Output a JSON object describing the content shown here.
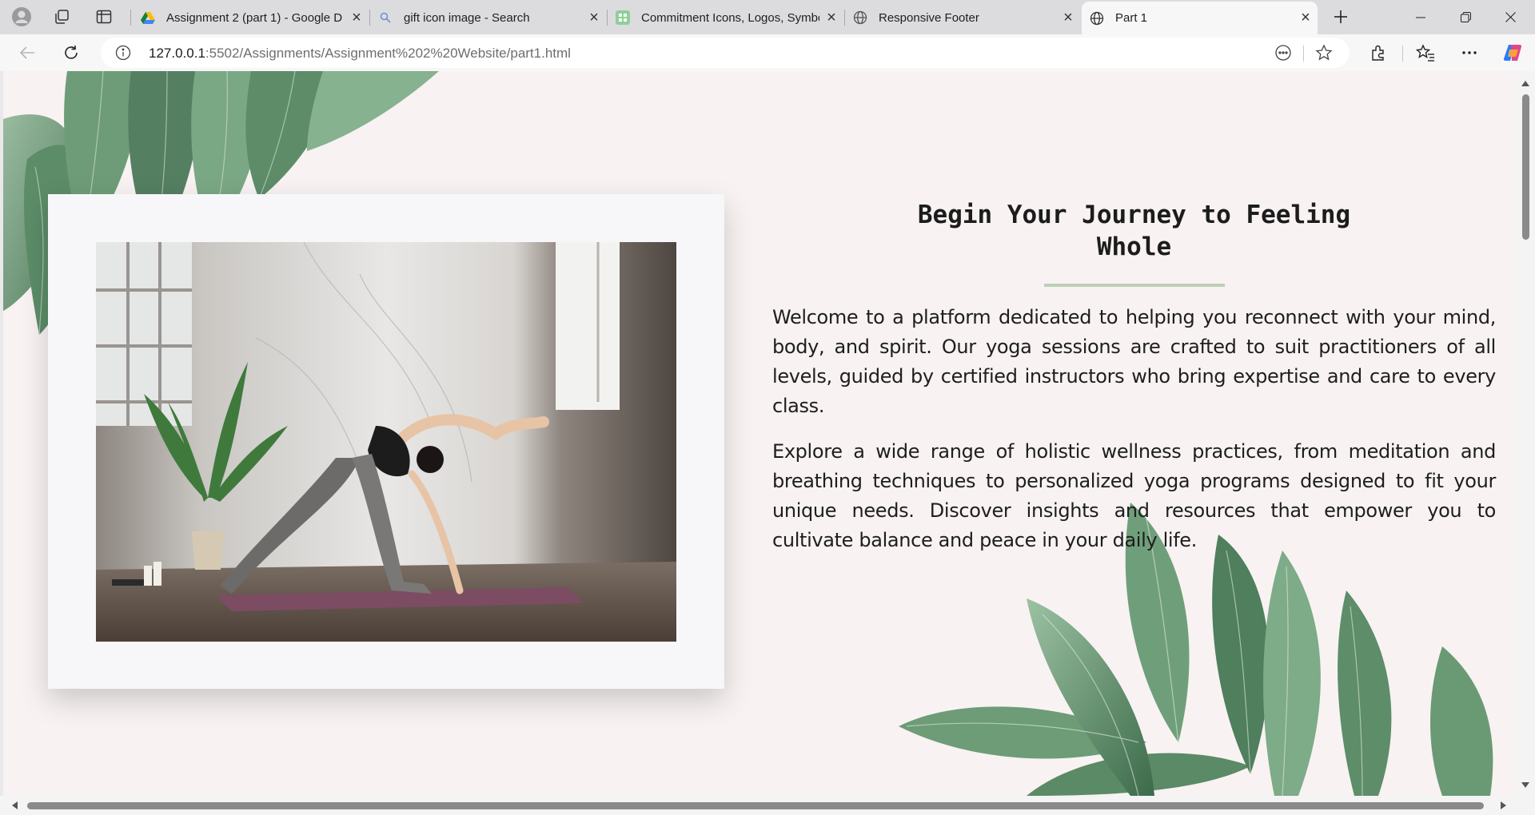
{
  "browser": {
    "tabs": [
      {
        "title": "Assignment 2 (part 1) - Google D",
        "favicon": "google-drive-icon",
        "active": false
      },
      {
        "title": "gift icon image - Search",
        "favicon": "search-icon",
        "active": false
      },
      {
        "title": "Commitment Icons, Logos, Symbo",
        "favicon": "green-square-icon",
        "active": false
      },
      {
        "title": "Responsive Footer",
        "favicon": "globe-icon",
        "active": false
      },
      {
        "title": "Part 1",
        "favicon": "globe-icon",
        "active": true
      }
    ],
    "url": {
      "host": "127.0.0.1",
      "rest": ":5502/Assignments/Assignment%202%20Website/part1.html"
    },
    "toolbar_icons": [
      "back-icon",
      "refresh-icon",
      "info-icon",
      "read-aloud-icon",
      "favorite-star-icon",
      "extensions-icon",
      "favorites-icon",
      "more-icon",
      "copilot-icon"
    ]
  },
  "page": {
    "heading": "Begin Your Journey to Feeling Whole",
    "paragraphs": [
      "Welcome to a platform dedicated to helping you reconnect with your mind, body, and spirit. Our yoga sessions are crafted to suit practitioners of all levels, guided by certified instructors who bring expertise and care to every class.",
      "Explore a wide range of holistic wellness practices, from meditation and breathing techniques to personalized yoga programs designed to fit your unique needs. Discover insights and resources that empower you to cultivate balance and peace in your daily life."
    ],
    "colors": {
      "background": "#f8f2f2",
      "card": "#f7f7f9",
      "accent_divider": "#bcd0b6",
      "leaf": "#5f8f6a"
    }
  }
}
